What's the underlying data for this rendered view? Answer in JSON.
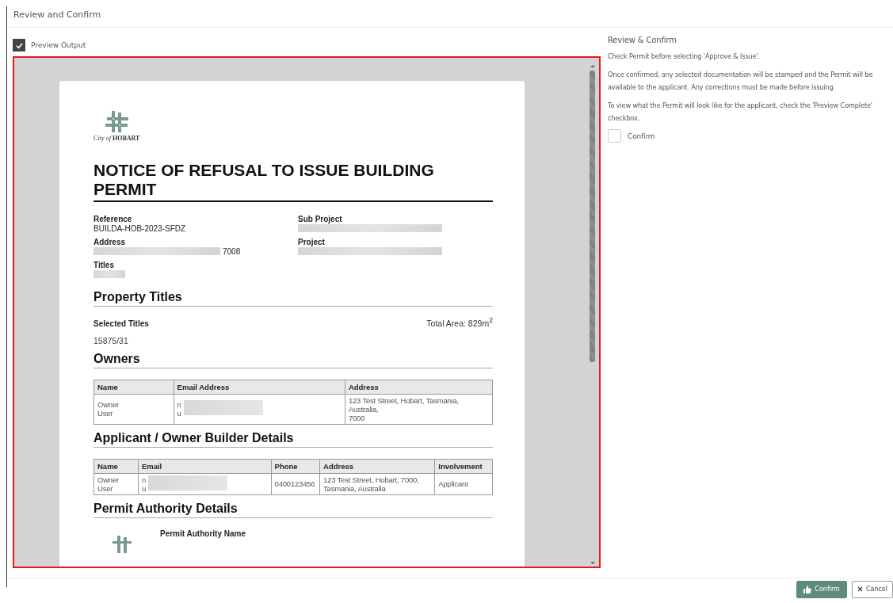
{
  "header": {
    "title": "Review and Confirm"
  },
  "preview_toggle": {
    "label": "Preview Output",
    "checked": true
  },
  "document": {
    "logo_text": "City *of* **HOBART**",
    "title": "NOTICE OF REFUSAL TO ISSUE BUILDING PERMIT",
    "fields": [
      {
        "label": "Reference",
        "value": "BUILDA-HOB-2023-SFDZ",
        "redacted": false
      },
      {
        "label": "Sub Project",
        "redacted": true
      },
      {
        "label": "Address",
        "value": "7008",
        "redacted": true
      },
      {
        "label": "Project",
        "redacted": true
      },
      {
        "label": "Titles",
        "redacted": true
      }
    ],
    "sections": [
      {
        "kind": "titles",
        "heading": "Property Titles",
        "label": "Selected Titles",
        "total_area": "Total Area: 829m$^{2}$",
        "items": [
          "15875/31"
        ]
      },
      {
        "kind": "table",
        "heading": "Owners",
        "columns": [
          "Name",
          "Email Address",
          "Address"
        ],
        "rows": [
          [
            {
              "lines": [
                "Owner",
                "User"
              ],
              "redacted": false
            },
            {
              "lines": [
                "n",
                "u"
              ],
              "redacted": true
            },
            {
              "lines": [
                "123 Test Street, Hobart, Tasmania, Australia,",
                "7000"
              ],
              "redacted": false
            }
          ]
        ]
      },
      {
        "kind": "table",
        "heading": "Applicant / Owner Builder Details",
        "columns": [
          "Name",
          "Email",
          "Phone",
          "Address",
          "Involvement"
        ],
        "rows": [
          [
            {
              "lines": [
                "Owner",
                "User"
              ],
              "redacted": false
            },
            {
              "lines": [
                "n",
                "u"
              ],
              "redacted": true
            },
            {
              "lines": [
                "0400123456"
              ],
              "redacted": false
            },
            {
              "lines": [
                "123 Test Street, Hobart, 7000,",
                "Tasmania, Australia"
              ],
              "redacted": false
            },
            {
              "lines": [
                "Applicant"
              ],
              "redacted": false
            }
          ]
        ]
      },
      {
        "kind": "authority",
        "heading": "Permit Authority Details",
        "label": "Permit Authority Name"
      }
    ]
  },
  "side_panel": {
    "title": "Review & Confirm",
    "paragraphs": [
      "Check Permit before selecting 'Approve & Issue'.",
      "Once confirmed, any selected documentation will be stamped and the Permit will be available to the applicant. Any corrections must be made before issuing.",
      "To view what the Permit will look like for the applicant, check the 'Preview Complete' checkbox."
    ],
    "confirm": {
      "label": "Confirm",
      "checked": false
    }
  },
  "buttons": [
    {
      "kind": "primary",
      "label": "Confirm"
    },
    {
      "kind": "cancel",
      "label": "Cancel"
    }
  ]
}
